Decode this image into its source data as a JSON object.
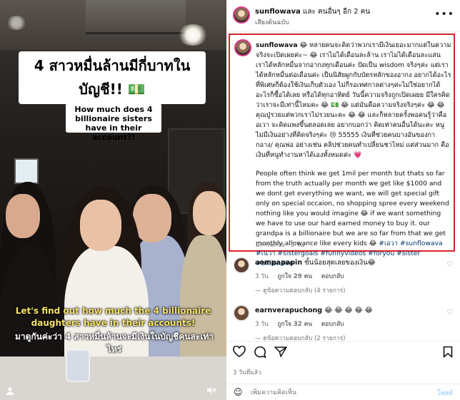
{
  "video": {
    "title_overlay": "4 สาวหมื่นล้านมีกี่บาทใน บัญชี!! 💵",
    "subtitle_overlay": "How much does 4 billionaire sisters have in their account?!",
    "caption_en": "Let's find out how much the 4 billionaire daughters have in their accounts!",
    "caption_th": "มาดูกันค่ะว่า 4 สาวหมื่นล้านจะมีเงินในบัญชีคนละเท่าไหร่",
    "user_icon": "user-icon",
    "mute_icon": "speaker-muted-icon"
  },
  "header": {
    "username": "sunflowava",
    "collab_text": "และ คนอื่นๆ อีก 2 คน",
    "audio": "เสียงต้นฉบับ",
    "more": "•••"
  },
  "caption": {
    "username": "sunflowava",
    "text_th": "😂 หลายคนจะคิดว่าพวกเรามีเงินเยอะมากแต่ในความจริงจะเปิดเผยค่ะ~ 😂 เราไม่ได้เดือนละล้าน เราไม่ได้เดือนละแสน เราได้หลักหมื่นจากอากงทุกเดือนค่ะ ปัดเป็น wisdom จริงๆค่ะ แต่เราได้หลักหมื่นต่อเดือนค่ะ เป็นนิสัยผูกกับบัตรหลักของอากง อยากได้อะไรที่พิเศษก็ต้องใช้เงินเก็บตัวเอง ไม่ก็รอเทศกาลต่างๆค่ะไม่ใช่อยากได้อะไรก็ซื้อได้เลย หรือได้ทุกอาทิตย์ วันนี้ความจริงถูกเปิดเผยย มีใครคิดว่าเราจะมีเท่านี้ไหมคะ 😂 💵 😂 แต่มันคือความจริงจริงๆค่ะ 😂 😂 คุณปู่รวยแต่พวกเราไม่รวยนะคะ 😂 😂 และก็หลายครั้งพอคนรู้ว่าคืออเวา จะคิดแพงขึ้นตลอดเลย อยากบอกว่า คิดเท่าคนอื่นได้นะคะ หนูไม่มีเงินอย่างที่คิดจริงๆค่ะ 😢 55555 เงินที่ช่วยคนบางอันของกากอาง/ คุณพ่อ อย่างเช่น คลิปช่วยคนทำเปลี่ยนชาไหม่ แต่ส่วนมาก คือเงินที่หนูทำงานหาได้เองทั้งหมดค่ะ 💗",
    "text_en": "People often think we get 1mil per month but thats so far from the truth actually per month we get like $1000 and we dont get everything we want, we will get special gift only on special occaion, no shopping spree every weekend nothing like you would imagine 😂 if we want something we have to use our hard earned money to buy it. our grandpa is a billionaire but we are so far from that we get monthly allowance like every kids 😂",
    "tags": "#เอวา #sunflowava #เนวา #sistergoals #funnyvideos #foryou #sister #billionaire",
    "edited": "มีการแก้ไข · 5 วัน"
  },
  "comments": [
    {
      "username": "aompapapin",
      "text": "ขั้นน้อยสุดเลยของเงิน😂",
      "time": "3 วัน",
      "likes": "ถูกใจ 29 คน",
      "reply": "ตอบกลับ",
      "replies": "— ดูข้อความตอบกลับ (4 รายการ)"
    },
    {
      "username": "earnverapuchong",
      "text": "😂 😂 😂 😂 😂",
      "time": "3 วัน",
      "likes": "ถูกใจ 32 คน",
      "reply": "ตอบกลับ",
      "replies": "— ดูข้อความตอบกลับ (2 รายการ)"
    }
  ],
  "actions": {
    "like_icon": "heart-icon",
    "comment_icon": "comment-icon",
    "share_icon": "share-icon",
    "save_icon": "bookmark-icon",
    "date": "3 วันที่แล้ว"
  },
  "add_comment": {
    "placeholder": "เพิ่มความคิดเห็น",
    "post_label": "โพสต์"
  },
  "colors": {
    "highlight_border": "#d8232a",
    "hashtag": "#00376b",
    "caption_yellow": "#f5e36a"
  }
}
